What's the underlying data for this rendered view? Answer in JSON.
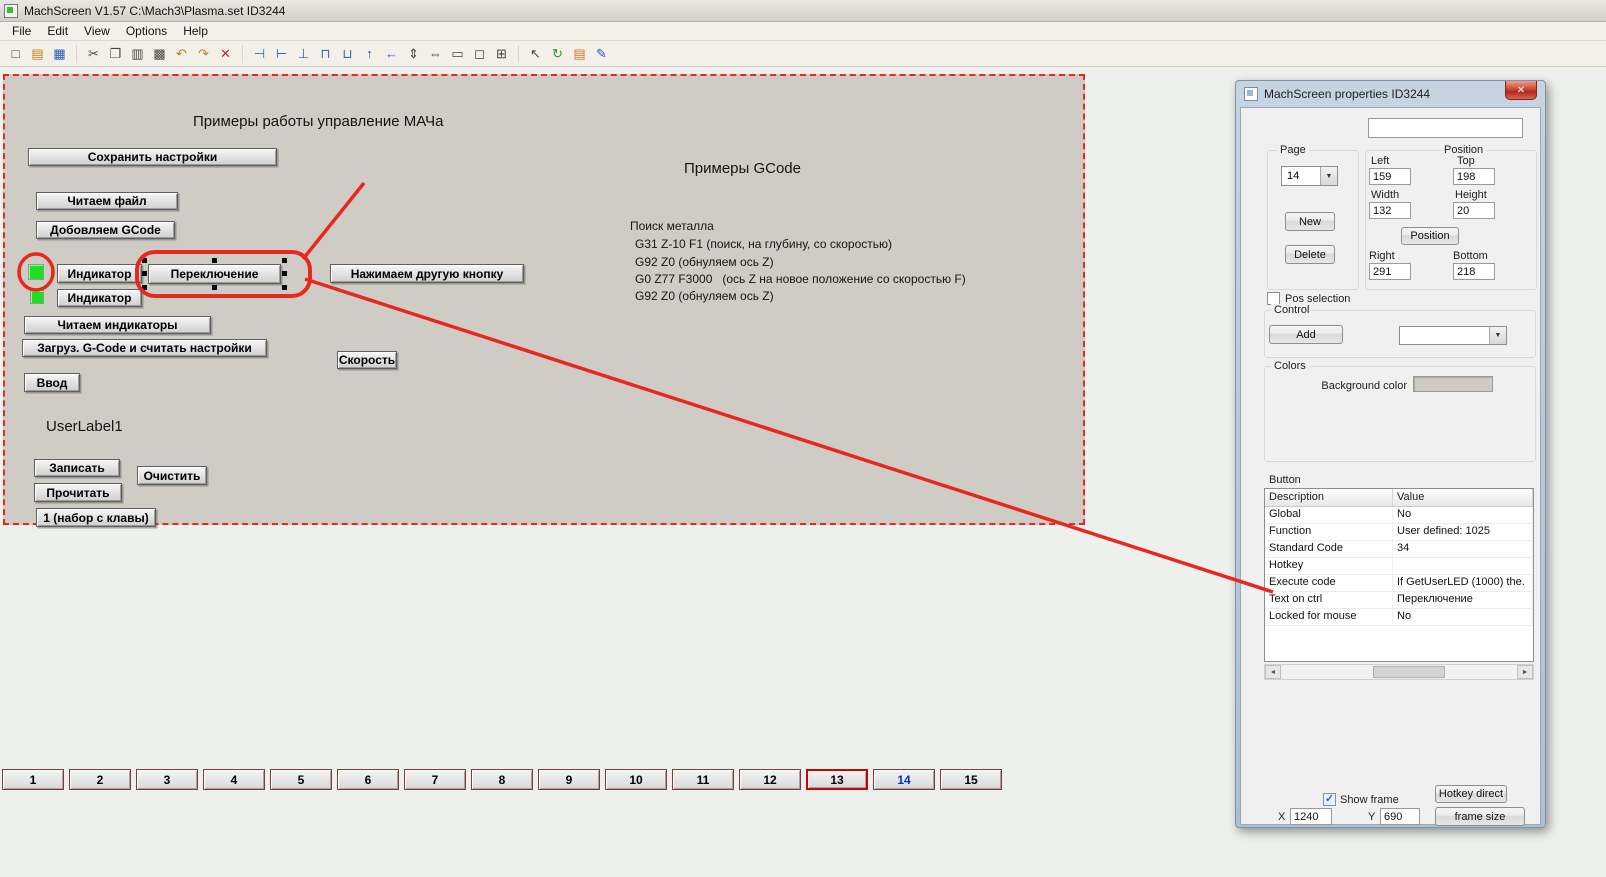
{
  "window": {
    "title": "MachScreen V1.57   C:\\Mach3\\Plasma.set   ID3244"
  },
  "menu": {
    "items": [
      "File",
      "Edit",
      "View",
      "Options",
      "Help"
    ]
  },
  "toolbar": {
    "icons": [
      {
        "name": "new-icon",
        "glyph": "□"
      },
      {
        "name": "open-icon",
        "glyph": "▤"
      },
      {
        "name": "save-icon",
        "glyph": "▦"
      },
      {
        "name": "cut-icon",
        "glyph": "✂"
      },
      {
        "name": "copy-icon",
        "glyph": "❐"
      },
      {
        "name": "paste-icon",
        "glyph": "▥"
      },
      {
        "name": "paste-special-icon",
        "glyph": "▩"
      },
      {
        "name": "undo-icon",
        "glyph": "↶"
      },
      {
        "name": "redo-icon",
        "glyph": "↷"
      },
      {
        "name": "delete-icon",
        "glyph": "✕"
      },
      {
        "name": "align-left-icon",
        "glyph": "⊣"
      },
      {
        "name": "align-right-icon",
        "glyph": "⊢"
      },
      {
        "name": "align-center-icon",
        "glyph": "⊥"
      },
      {
        "name": "align-top-icon",
        "glyph": "⊓"
      },
      {
        "name": "align-bottom-icon",
        "glyph": "⊔"
      },
      {
        "name": "move-up-icon",
        "glyph": "↑"
      },
      {
        "name": "move-left-icon",
        "glyph": "←"
      },
      {
        "name": "same-height-icon",
        "glyph": "⇕"
      },
      {
        "name": "same-width-icon",
        "glyph": "⇔"
      },
      {
        "name": "frame-icon",
        "glyph": "▭"
      },
      {
        "name": "dashed-frame-icon",
        "glyph": "◻"
      },
      {
        "name": "grid-icon",
        "glyph": "⊞"
      },
      {
        "name": "cursor-icon",
        "glyph": "↖"
      },
      {
        "name": "refresh-icon",
        "glyph": "↻"
      },
      {
        "name": "print-icon",
        "glyph": "▤"
      },
      {
        "name": "edit-icon",
        "glyph": "✎"
      }
    ]
  },
  "canvas": {
    "heading": "Примеры работы управление МАЧа",
    "user_label": "UserLabel1",
    "buttons": {
      "save_settings": "Сохранить настройки",
      "read_file": "Читаем файл",
      "add_gcode": "Добовляем GCode",
      "indicator_1": "Индикатор",
      "switch": "Переключение",
      "press_other": "Нажимаем другую кнопку",
      "indicator_2": "Индикатор",
      "read_indicators": "Читаем индикаторы",
      "load_gcode": "Загруз. G-Code и считать настройки",
      "speed": "Скорость",
      "input": "Ввод",
      "write": "Записать",
      "clear": "Очистить",
      "read": "Прочитать",
      "keys": "1 (набор с клавы)"
    },
    "gcode": {
      "heading": "Примеры GCode",
      "lines": [
        "Поиск металла",
        "G31 Z-10 F1 (поиск, на глубину, со скоростью)",
        "G92 Z0 (обнуляем ось Z)",
        "G0 Z77 F3000   (ось Z на новое положение со скоростью F)",
        "G92 Z0 (обнуляем ось Z)"
      ]
    }
  },
  "pages": {
    "items": [
      "1",
      "2",
      "3",
      "4",
      "5",
      "6",
      "7",
      "8",
      "9",
      "10",
      "11",
      "12",
      "13",
      "14",
      "15"
    ],
    "selected": "13",
    "active": "14"
  },
  "properties": {
    "title": "MachScreen properties  ID3244",
    "control_name": "",
    "page": {
      "label": "Page",
      "value": "14",
      "new": "New",
      "delete": "Delete"
    },
    "position": {
      "label": "Position",
      "button": "Position",
      "left_label": "Left",
      "left": "159",
      "top_label": "Top",
      "top": "198",
      "width_label": "Width",
      "width": "132",
      "height_label": "Height",
      "height": "20",
      "right_label": "Right",
      "right": "291",
      "bottom_label": "Bottom",
      "bottom": "218"
    },
    "pos_selection_label": "Pos selection",
    "control": {
      "label": "Control",
      "add": "Add"
    },
    "colors": {
      "label": "Colors",
      "background_label": "Background color",
      "background_value": "#cfccc5"
    },
    "button_grid": {
      "label": "Button",
      "headers": [
        "Description",
        "Value"
      ],
      "rows": [
        {
          "description": "Global",
          "value": "No"
        },
        {
          "description": "Function",
          "value": "User defined: 1025"
        },
        {
          "description": "Standard Code",
          "value": "34"
        },
        {
          "description": "Hotkey",
          "value": ""
        },
        {
          "description": "Execute code",
          "value": "If GetUserLED (1000) the."
        },
        {
          "description": "Text on ctrl",
          "value": "Переключение"
        },
        {
          "description": "Locked for mouse",
          "value": "No"
        }
      ]
    },
    "show_frame_label": "Show frame",
    "hotkey_direct": "Hotkey direct",
    "x_label": "X",
    "x": "1240",
    "y_label": "Y",
    "y": "690",
    "frame_size": "frame size"
  },
  "icons": {
    "close": "✕",
    "dropdown": "▼",
    "scroll_left": "◄",
    "scroll_right": "►",
    "check": "✓"
  },
  "colors": {
    "accent_red": "#e8281e",
    "led_green": "#1fe01f",
    "canvas_bg": "#cfccc5",
    "page_active_text": "#0033cc"
  }
}
